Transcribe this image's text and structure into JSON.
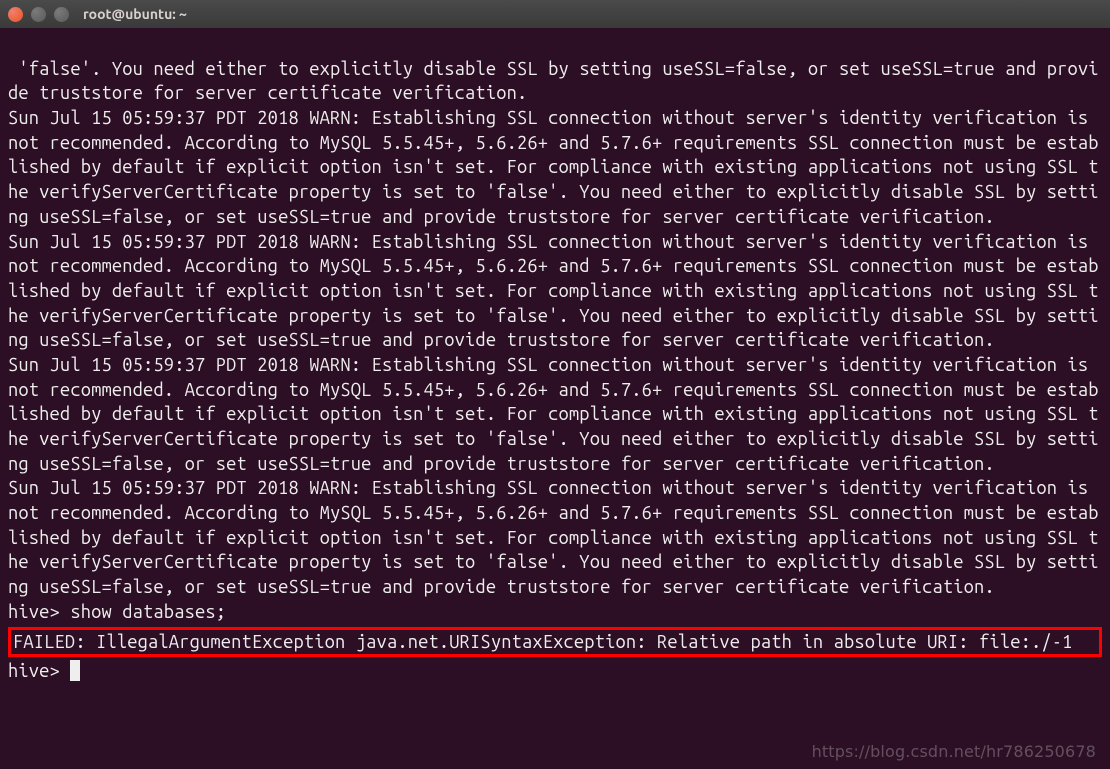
{
  "window": {
    "title": "root@ubuntu: ~"
  },
  "terminal": {
    "warn_intro": " 'false'. You need either to explicitly disable SSL by setting useSSL=false, or set useSSL=true and provide truststore for server certificate verification.",
    "warn_block": "Sun Jul 15 05:59:37 PDT 2018 WARN: Establishing SSL connection without server's identity verification is not recommended. According to MySQL 5.5.45+, 5.6.26+ and 5.7.6+ requirements SSL connection must be established by default if explicit option isn't set. For compliance with existing applications not using SSL the verifyServerCertificate property is set to 'false'. You need either to explicitly disable SSL by setting useSSL=false, or set useSSL=true and provide truststore for server certificate verification.",
    "hive_cmd": "hive> show databases;",
    "error_line": "FAILED: IllegalArgumentException java.net.URISyntaxException: Relative path in absolute URI: file:./-1",
    "prompt": "hive> "
  },
  "watermark": "https://blog.csdn.net/hr786250678"
}
